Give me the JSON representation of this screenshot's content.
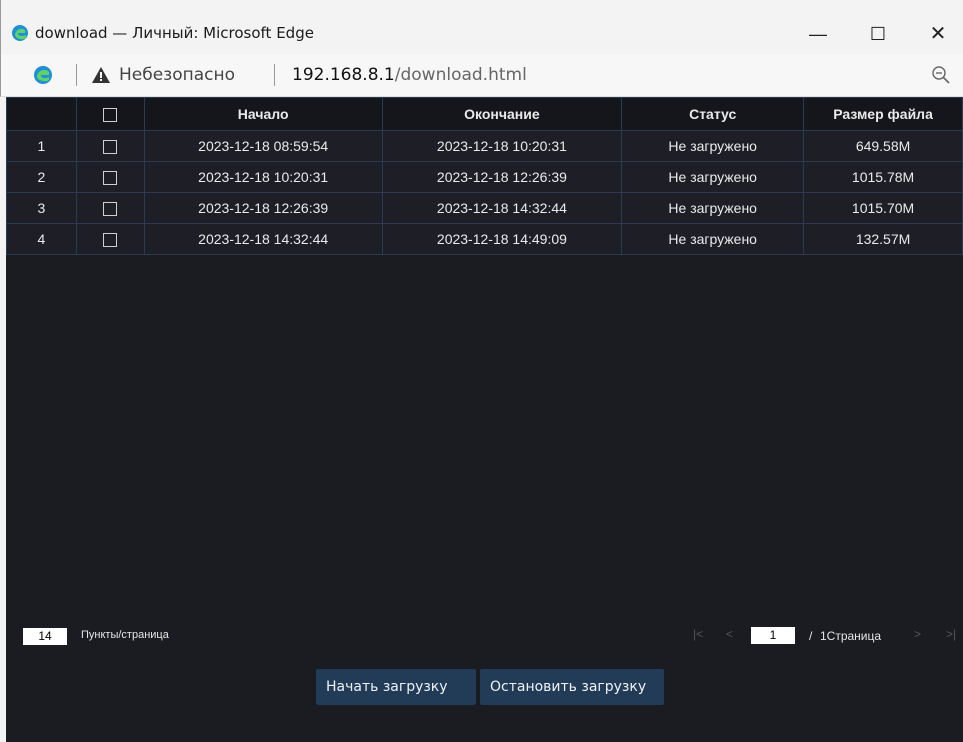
{
  "window": {
    "title": "download — Личный: Microsoft Edge",
    "minimize": "—",
    "maximize": "☐",
    "close": "✕"
  },
  "addressbar": {
    "security_label": "Небезопасно",
    "host": "192.168.8.1",
    "path": "/download.html"
  },
  "table": {
    "headers": [
      "",
      "",
      "Начало",
      "Окончание",
      "Статус",
      "Размер файла"
    ],
    "rows": [
      {
        "num": "1",
        "start": "2023-12-18 08:59:54",
        "end": "2023-12-18 10:20:31",
        "status": "Не загружено",
        "size": "649.58M"
      },
      {
        "num": "2",
        "start": "2023-12-18 10:20:31",
        "end": "2023-12-18 12:26:39",
        "status": "Не загружено",
        "size": "1015.78M"
      },
      {
        "num": "3",
        "start": "2023-12-18 12:26:39",
        "end": "2023-12-18 14:32:44",
        "status": "Не загружено",
        "size": "1015.70M"
      },
      {
        "num": "4",
        "start": "2023-12-18 14:32:44",
        "end": "2023-12-18 14:49:09",
        "status": "Не загружено",
        "size": "132.57M"
      }
    ]
  },
  "pager": {
    "per_page": "14",
    "per_page_label": "Пункты/страница",
    "first": "|<",
    "prev": "<",
    "current_page": "1",
    "slash": "/",
    "total": "1Страница",
    "next": ">",
    "last": ">|"
  },
  "actions": {
    "start_label": "Начать загрузку",
    "stop_label": "Остановить загрузку"
  },
  "colors": {
    "content_bg": "#1b1c22",
    "button_bg": "#223c57",
    "grid_border": "#2b3b52"
  }
}
